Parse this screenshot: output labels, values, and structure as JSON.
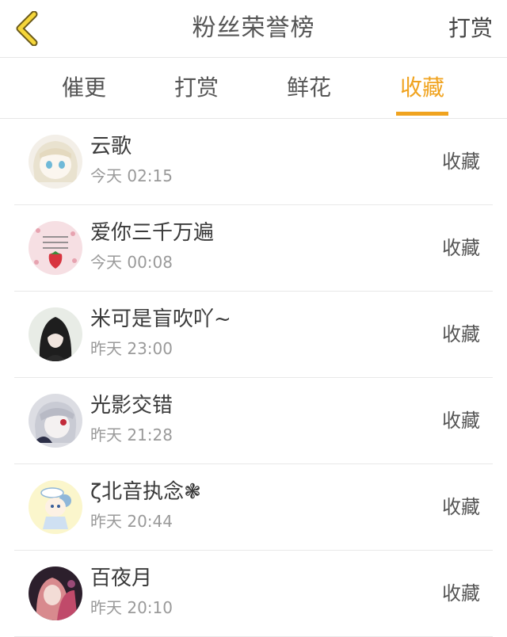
{
  "header": {
    "title": "粉丝荣誉榜",
    "right_action": "打赏",
    "back_icon": "chevron-left-icon",
    "accent_color": "#f0a31f"
  },
  "tabs": [
    {
      "label": "催更",
      "active": false
    },
    {
      "label": "打赏",
      "active": false
    },
    {
      "label": "鲜花",
      "active": false
    },
    {
      "label": "收藏",
      "active": true
    }
  ],
  "list": [
    {
      "name": "云歌",
      "time": "今天 02:15",
      "action": "收藏"
    },
    {
      "name": "爱你三千万遍",
      "time": "今天 00:08",
      "action": "收藏"
    },
    {
      "name": "米可是盲吹吖~",
      "time": "昨天 23:00",
      "action": "收藏"
    },
    {
      "name": "光影交错",
      "time": "昨天 21:28",
      "action": "收藏"
    },
    {
      "name": "ζ北音执念❃",
      "time": "昨天 20:44",
      "action": "收藏"
    },
    {
      "name": "百夜月",
      "time": "昨天 20:10",
      "action": "收藏"
    }
  ]
}
